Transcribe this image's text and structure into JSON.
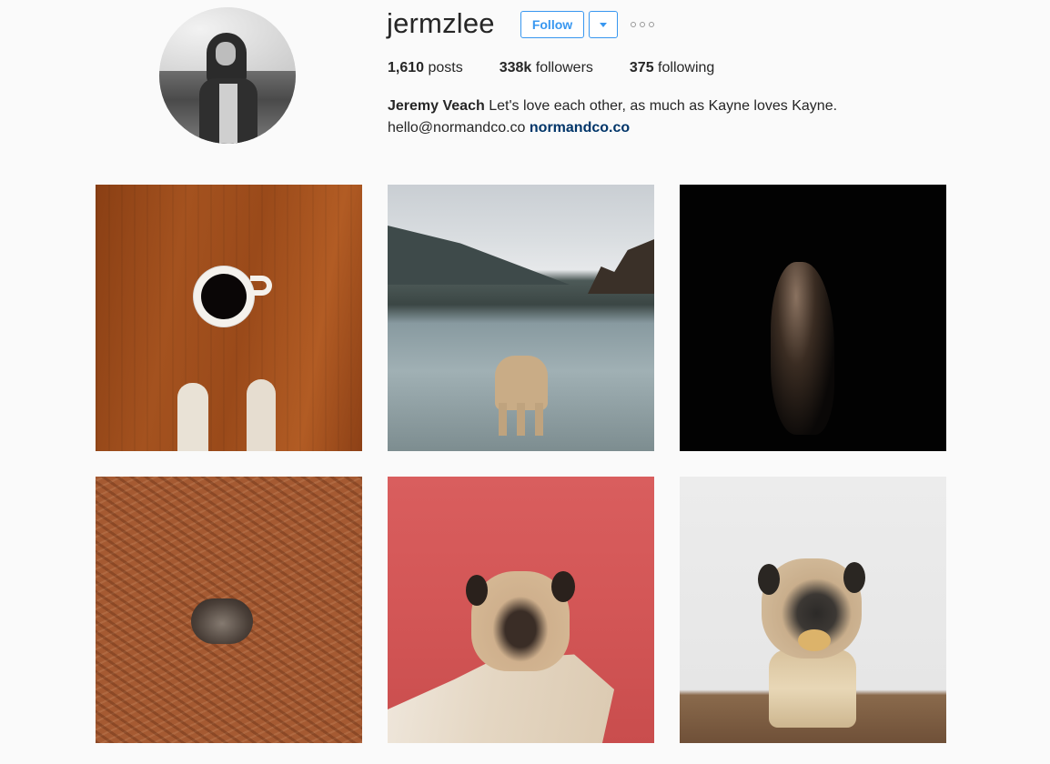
{
  "profile": {
    "username": "jermzlee",
    "follow_label": "Follow",
    "stats": {
      "posts_count": "1,610",
      "posts_label": " posts",
      "followers_count": "338k",
      "followers_label": " followers",
      "following_count": "375",
      "following_label": " following"
    },
    "bio": {
      "name": "Jeremy Veach",
      "text": " Let's love each other, as much as Kayne loves Kayne.",
      "email": "hello@normandco.co",
      "link": "normandco.co"
    }
  },
  "colors": {
    "accent": "#3897f0",
    "link": "#003569",
    "background": "#fafafa",
    "text": "#262626"
  },
  "icons": {
    "dropdown": "chevron-down-icon",
    "more": "more-options-icon"
  }
}
